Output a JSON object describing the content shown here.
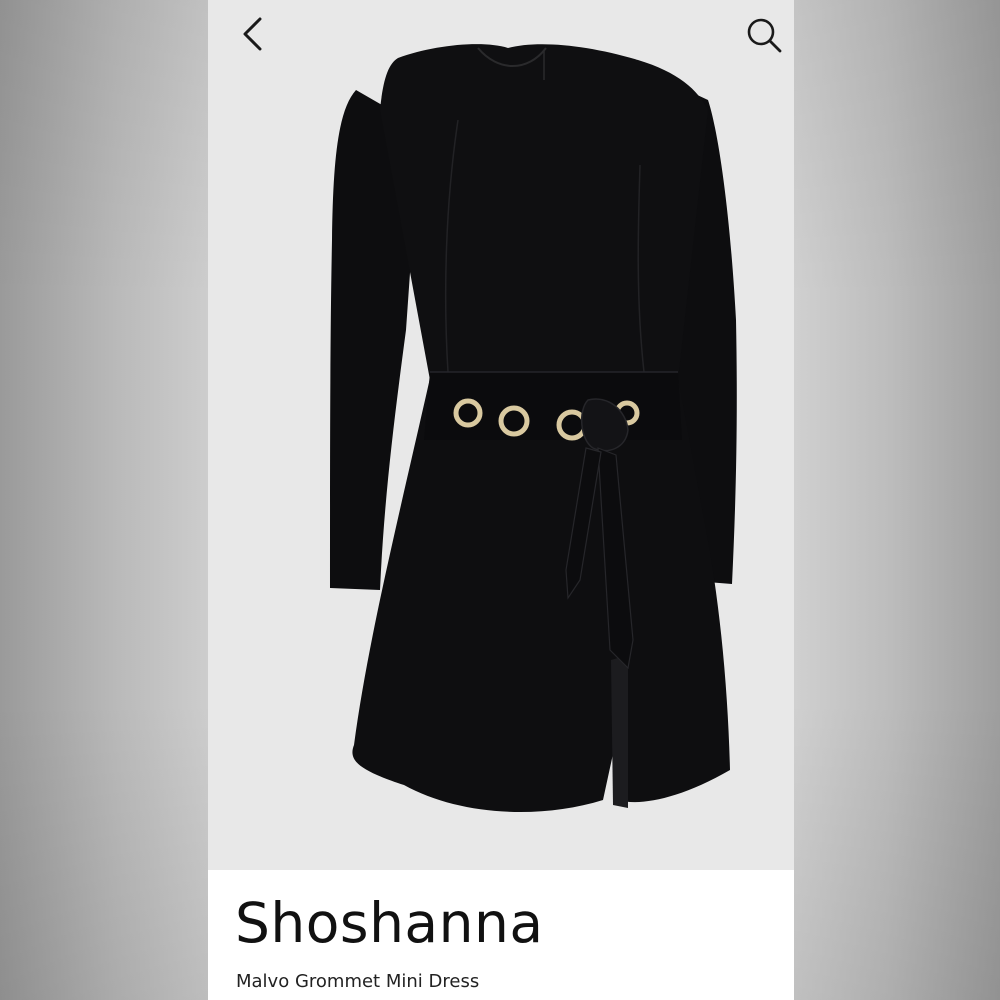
{
  "header": {
    "back_icon": "chevron-left-icon",
    "search_icon": "search-icon"
  },
  "product": {
    "brand": "Shoshanna",
    "name": "Malvo Grommet Mini Dress",
    "image": {
      "subject": "black long-sleeve mini dress with gold grommet tie belt",
      "dress_color": "#0d0d0f",
      "grommet_color": "#d9c9a0",
      "background_color": "#e8e8e8"
    }
  },
  "colors": {
    "panel_background": "#ffffff",
    "text": "#111111",
    "icon": "#1a1a1a"
  }
}
